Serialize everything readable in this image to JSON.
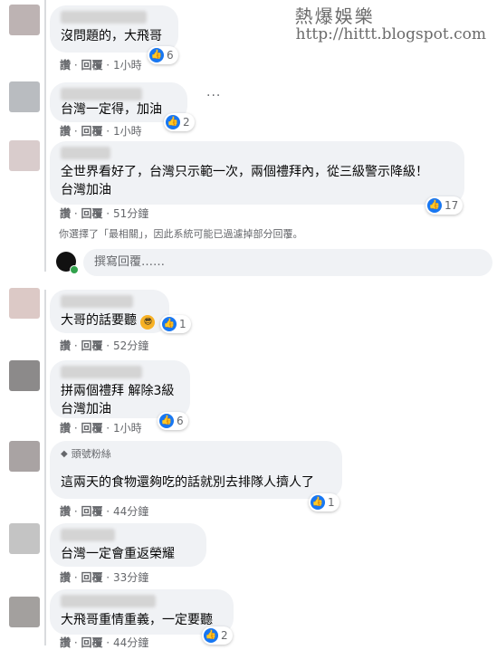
{
  "watermark": {
    "title": "熱爆娛樂",
    "url": "http://hittt.blogspot.com"
  },
  "reply_placeholder": "撰寫回覆……",
  "filter_note": "你選擇了「最相關」，因此系統可能已過濾掉部分回覆。",
  "more_label": "···",
  "comments": [
    {
      "text": "沒問題的，大飛哥",
      "reactions": "6",
      "like": "讚",
      "reply": "回覆",
      "time": "1小時"
    },
    {
      "text": "台灣一定得，加油",
      "reactions": "2",
      "like": "讚",
      "reply": "回覆",
      "time": "1小時"
    },
    {
      "text": "全世界看好了，台灣只示範一次，兩個禮拜內，從三級警示降級！\n台灣加油",
      "reactions": "17",
      "like": "讚",
      "reply": "回覆",
      "time": "51分鐘"
    },
    {
      "text": "大哥的話要聽",
      "reactions": "1",
      "like": "讚",
      "reply": "回覆",
      "time": "52分鐘"
    },
    {
      "text": "拼兩個禮拜 解除3級\n台灣加油",
      "reactions": "6",
      "like": "讚",
      "reply": "回覆",
      "time": "1小時"
    },
    {
      "fan_badge": "頭號粉絲",
      "text": "這兩天的食物還夠吃的話就別去排隊人擠人了",
      "reactions": "1",
      "like": "讚",
      "reply": "回覆",
      "time": "44分鐘"
    },
    {
      "text": "台灣一定會重返榮耀",
      "like": "讚",
      "reply": "回覆",
      "time": "33分鐘"
    },
    {
      "text": "大飛哥重情重義，一定要聽",
      "reactions": "2",
      "like": "讚",
      "reply": "回覆",
      "time": "44分鐘"
    }
  ],
  "icons": {
    "like": "thumbs-up-icon",
    "cool": "sunglasses-emoji-icon",
    "strong": "flexed-arm-icon"
  },
  "colors": {
    "bubble": "#f0f2f5",
    "like_blue": "#1877f2",
    "meta_gray": "#65676b"
  }
}
